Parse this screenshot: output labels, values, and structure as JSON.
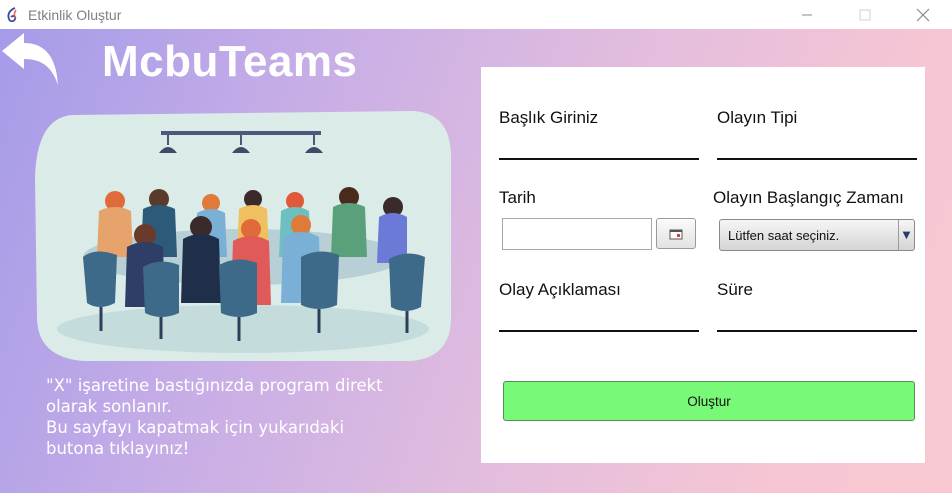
{
  "window": {
    "title": "Etkinlik Oluştur",
    "controls": {
      "minimize": "—",
      "maximize": "☐",
      "close": "✕"
    }
  },
  "brand": {
    "name": "McbuTeams"
  },
  "illustration": {
    "icon": "team-meeting-illustration"
  },
  "note": {
    "lines": [
      "\"X\" işaretine bastığınızda program direkt",
      "olarak sonlanır.",
      "Bu sayfayı kapatmak için yukarıdaki",
      "butona tıklayınız!"
    ]
  },
  "form": {
    "title_label": "Başlık Giriniz",
    "type_label": "Olayın Tipi",
    "date_label": "Tarih",
    "date_value": "",
    "start_time_label": "Olayın Başlangıç Zamanı",
    "start_time_selected": "Lütfen saat seçiniz.",
    "description_label": "Olay Açıklaması",
    "duration_label": "Süre",
    "submit_label": "Oluştur"
  },
  "colors": {
    "gradient_start": "#a59be9",
    "gradient_end": "#f9c8d2",
    "submit_bg": "#78fa78"
  }
}
